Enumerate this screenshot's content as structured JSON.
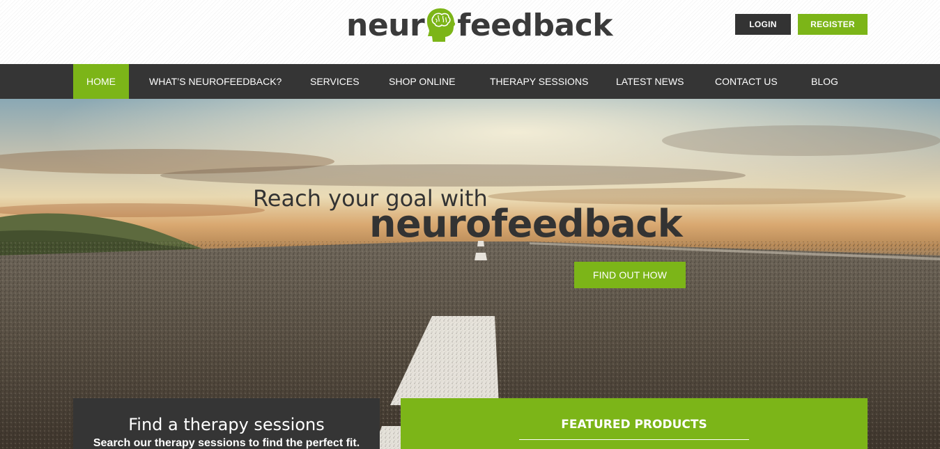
{
  "header": {
    "logo_text_left": "neur",
    "logo_text_right": "feedback",
    "login_label": "LOGIN",
    "register_label": "REGISTER"
  },
  "nav": {
    "items": [
      {
        "label": "HOME",
        "active": true
      },
      {
        "label": "WHAT’S NEUROFEEDBACK?"
      },
      {
        "label": "SERVICES"
      },
      {
        "label": "SHOP ONLINE"
      },
      {
        "label": "THERAPY SESSIONS"
      },
      {
        "label": "LATEST NEWS"
      },
      {
        "label": "CONTACT US"
      },
      {
        "label": "BLOG"
      }
    ]
  },
  "hero": {
    "line1": "Reach your goal with",
    "line2": "neurofeedback",
    "cta_label": "FIND OUT HOW"
  },
  "therapy_panel": {
    "title": "Find a therapy sessions",
    "subtitle": "Search our therapy sessions to find the perfect fit."
  },
  "featured_panel": {
    "title": "FEATURED PRODUCTS"
  },
  "colors": {
    "accent_green": "#7cb518",
    "dark": "#353535",
    "text_dark": "#333333"
  },
  "icons": {
    "logo_icon": "head-brain-icon"
  }
}
